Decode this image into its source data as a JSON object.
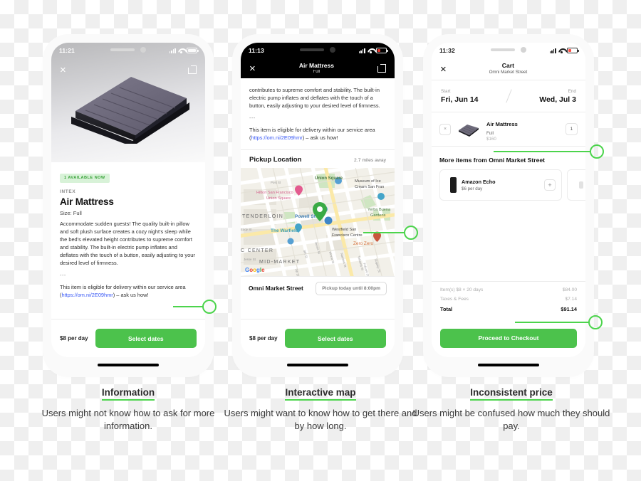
{
  "phone1": {
    "status": {
      "time": "11:21",
      "signal": "signal-bars-icon",
      "wifi": "wifi-icon",
      "battery": "battery-full-icon"
    },
    "nav": {
      "close": "×",
      "share": "share-icon"
    },
    "badge": "1 AVAILABLE NOW",
    "brand": "INTEX",
    "title": "Air Mattress",
    "size": "Size: Full",
    "description": "Accommodate sudden guests! The quality built-in pillow and soft plush surface creates a cozy night's sleep while the bed's elevated height contributes to supreme comfort and stability. The built-in electric pump inflates and deflates with the touch of a button, easily adjusting to your desired level of firmness.",
    "divider": "---",
    "eligibility_pre": "This item is eligible for delivery within our service area (",
    "eligibility_link": "https://om.ni/2E09hmr",
    "eligibility_post": ") – ask us how!",
    "price": "$8 per day",
    "cta": "Select dates"
  },
  "phone2": {
    "status": {
      "time": "11:13",
      "signal": "signal-bars-icon",
      "wifi": "wifi-icon",
      "battery": "battery-low-icon"
    },
    "nav": {
      "close": "×",
      "title": "Air Mattress",
      "subtitle": "Full",
      "share": "share-icon"
    },
    "description_tail": "contributes to supreme comfort and stability. The built-in electric pump inflates and deflates with the touch of a button, easily adjusting to your desired level of firmness.",
    "divider": "---",
    "eligibility_pre": "This item is eligible for delivery within our service area (",
    "eligibility_link": "https://om.ni/2E09hmr",
    "eligibility_post": ") – ask us how!",
    "section_title": "Pickup Location",
    "distance": "2.7 miles away",
    "map": {
      "labels": [
        "Union Square",
        "Museum of Ice Cream San Fran",
        "Hilton San Francisco Union Square",
        "Yerba Buena Gardens",
        "TENDERLOIN",
        "Powell St",
        "Westfield San Francisco Centre",
        "The Warfield",
        "Zero Zero",
        "C CENTER",
        "MID-MARKET",
        "Post St",
        "Eddy St",
        "Jessie St",
        "8th St",
        "Minna St",
        "Natoma St",
        "Tehama St",
        "Folsom St",
        "Shipley St",
        "7th St"
      ],
      "attribution": "Google",
      "pin": "map-pin-icon"
    },
    "pickup_name": "Omni Market Street",
    "pickup_pill": "Pickup today until 8:00pm",
    "price": "$8 per day",
    "cta": "Select dates"
  },
  "phone3": {
    "status": {
      "time": "11:32",
      "signal": "signal-bars-icon",
      "wifi": "wifi-icon",
      "battery": "battery-low-icon"
    },
    "nav": {
      "close": "×",
      "title": "Cart",
      "subtitle": "Omni Market Street"
    },
    "dates": {
      "start_label": "Start",
      "start_value": "Fri, Jun 14",
      "end_label": "End",
      "end_value": "Wed, Jul 3"
    },
    "cart_item": {
      "remove": "×",
      "name": "Air Mattress",
      "size": "Full",
      "price": "$160",
      "qty": "1"
    },
    "more_title": "More items from Omni Market Street",
    "more_items": [
      {
        "name": "Amazon Echo",
        "price": "$6 per day",
        "add": "+"
      }
    ],
    "summary": [
      {
        "label": "Item(s) $8 × 20 days",
        "value": "$84.00"
      },
      {
        "label": "Taxes & Fees",
        "value": "$7.14"
      }
    ],
    "total": {
      "label": "Total",
      "value": "$91.14"
    },
    "cta": "Proceed to Checkout"
  },
  "captions": [
    {
      "heading": "Information",
      "body": "Users might not know how to ask for more information."
    },
    {
      "heading": "Interactive map",
      "body": "Users might want to know how to get there and by how long."
    },
    {
      "heading": "Inconsistent price",
      "body": "Users might be confused how much they should pay."
    }
  ],
  "colors": {
    "accent_green": "#4cc24c",
    "anno_green": "#4cd44c",
    "link_blue": "#3858f6",
    "badge_bg": "#d8f2d8"
  }
}
